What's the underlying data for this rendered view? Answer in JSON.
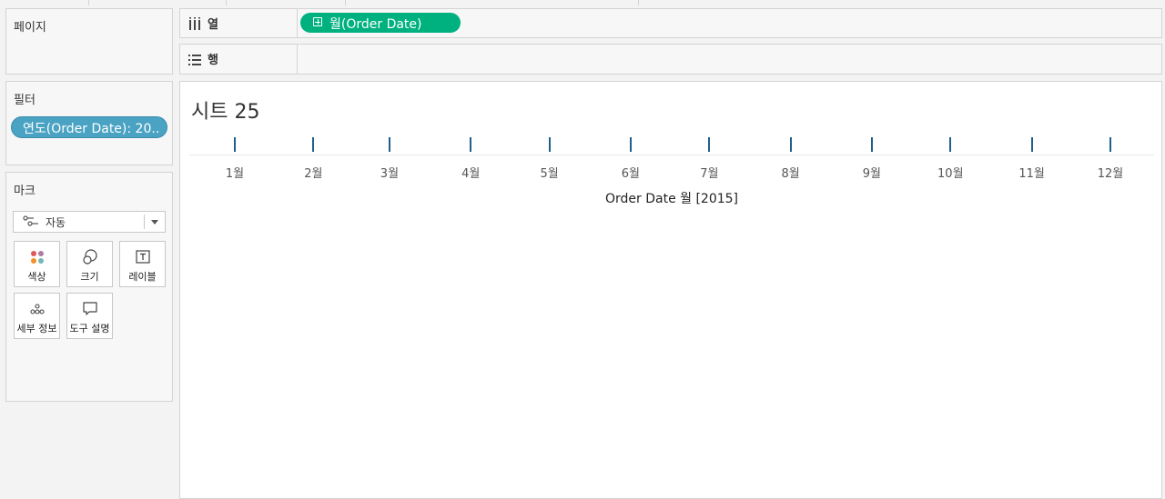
{
  "pages_panel": {
    "title": "페이지"
  },
  "filters_panel": {
    "title": "필터",
    "filter_pill": "연도(Order Date): 20.."
  },
  "marks_panel": {
    "title": "마크",
    "mark_type": "자동",
    "buttons": {
      "color": "색상",
      "size": "크기",
      "label": "레이블",
      "detail": "세부 정보",
      "tooltip": "도구 설명"
    }
  },
  "columns_shelf": {
    "label": "열",
    "pill": "월(Order Date)"
  },
  "rows_shelf": {
    "label": "행"
  },
  "view": {
    "sheet_title": "시트 25",
    "axis_title": "Order Date 월 [2015]",
    "months": [
      "1월",
      "2월",
      "3월",
      "4월",
      "5월",
      "6월",
      "7월",
      "8월",
      "9월",
      "10월",
      "11월",
      "12월"
    ]
  },
  "colors": {
    "dimension_pill": "#00b180",
    "filter_pill": "#4ba3c3",
    "tick_mark": "#1f5f8b"
  }
}
